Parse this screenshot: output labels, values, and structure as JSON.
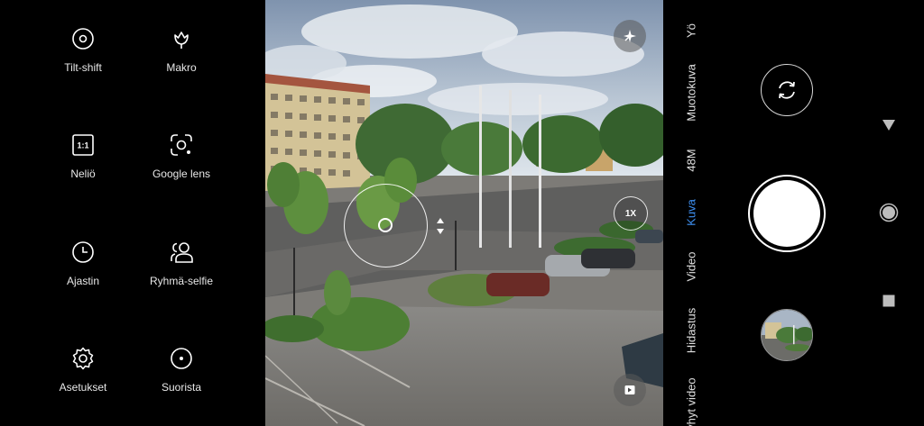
{
  "menu": {
    "items": [
      {
        "label": "Tilt-shift",
        "icon": "tilt-shift-icon"
      },
      {
        "label": "Makro",
        "icon": "flower-icon"
      },
      {
        "label": "Neliö",
        "icon": "square-1-1-icon"
      },
      {
        "label": "Google lens",
        "icon": "google-lens-icon"
      },
      {
        "label": "Ajastin",
        "icon": "timer-icon"
      },
      {
        "label": "Ryhmä-selfie",
        "icon": "group-selfie-icon"
      },
      {
        "label": "Asetukset",
        "icon": "gear-icon"
      },
      {
        "label": "Suorista",
        "icon": "straighten-icon"
      }
    ]
  },
  "viewfinder": {
    "zoom_label": "1X",
    "ai_icon": "ai-sparkle-icon",
    "video_tag_icon": "flag-icon"
  },
  "modes": {
    "items": [
      "Yö",
      "Muotokuva",
      "48M",
      "Kuva",
      "Video",
      "Hidastus",
      "Lyhyt video"
    ],
    "active": "Kuva",
    "active_color": "#3e8ff0"
  },
  "controls": {
    "switch_icon": "switch-camera-icon",
    "shutter_icon": "shutter-button",
    "thumbnail": "last-photo-thumbnail"
  },
  "system_nav": {
    "items": [
      "back-icon",
      "home-icon",
      "recents-icon"
    ]
  }
}
